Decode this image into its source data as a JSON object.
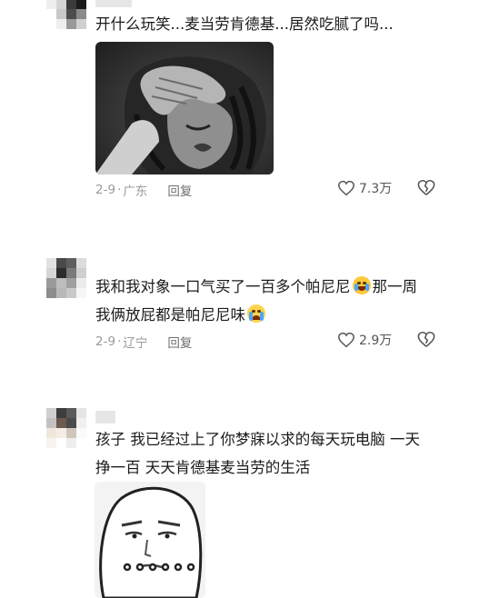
{
  "comments": [
    {
      "text_lines": [
        "开什么玩笑...麦当劳肯德基...居然吃腻了吗..."
      ],
      "has_image": true,
      "date": "2-9",
      "location": "广东",
      "reply_label": "回复",
      "likes": "7.3万"
    },
    {
      "text_line1_part1": "我和我对象一口气买了一百多个帕尼尼",
      "text_line1_emoji": "laughing-crying-emoji",
      "text_line1_part2": "那一周",
      "text_line2_part1": "我俩放屁都是帕尼尼味",
      "text_line2_emoji": "crying-emoji",
      "date": "2-9",
      "location": "辽宁",
      "reply_label": "回复",
      "likes": "2.9万"
    },
    {
      "text_lines": [
        "孩子 我已经过上了你梦寐以求的每天玩电脑 一天",
        "挣一百 天天肯德基麦当劳的生活"
      ],
      "has_sticker": true
    }
  ],
  "colors": {
    "meta_text": "#9a9a9a",
    "emoji_yellow": "#ffc83d"
  },
  "separator": "·"
}
